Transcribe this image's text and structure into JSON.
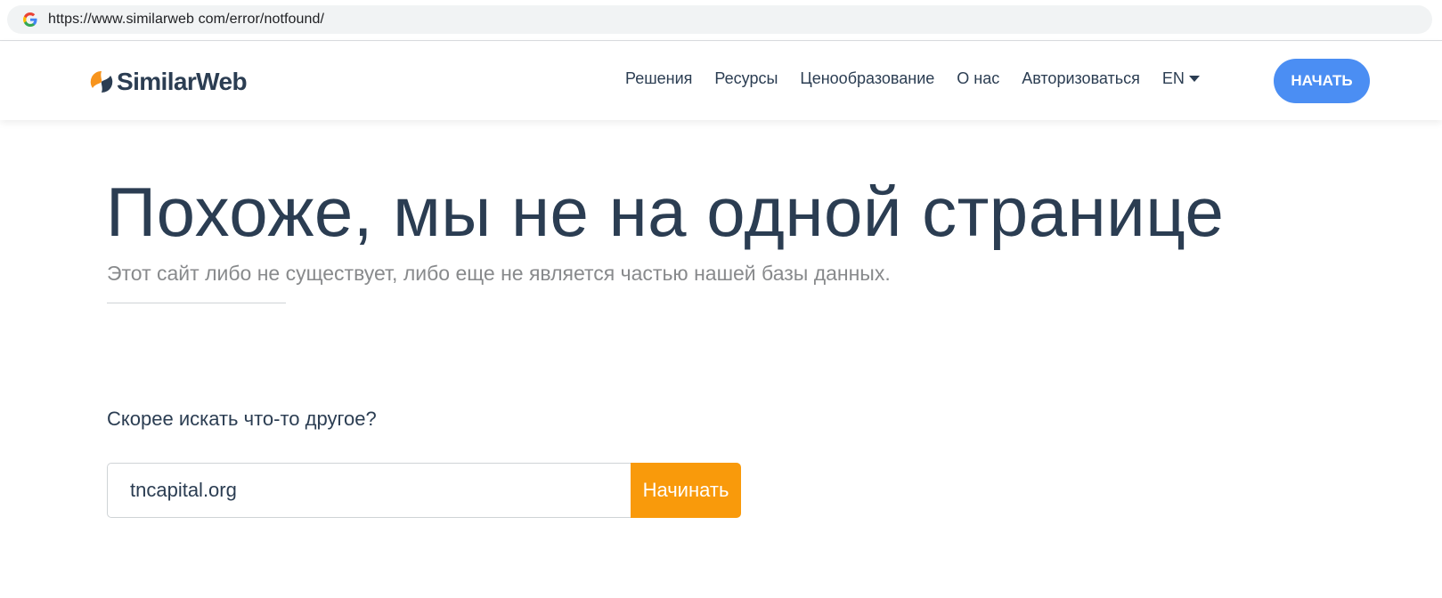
{
  "browser": {
    "url": "https://www.similarweb com/error/notfound/",
    "favicon": "google-g-icon"
  },
  "header": {
    "logo_text": "SimilarWeb",
    "nav": [
      "Решения",
      "Ресурсы",
      "Ценообразование",
      "О нас",
      "Авторизоваться"
    ],
    "language": "EN",
    "cta_label": "НАЧАТЬ"
  },
  "main": {
    "title": "Похоже, мы не на одной странице",
    "subtitle": "Этот сайт либо не существует, либо еще не является частью нашей базы данных.",
    "search_prompt": "Скорее искать что-то другое?",
    "search_value": "tncapital.org",
    "search_button": "Начинать"
  },
  "colors": {
    "text_primary": "#2b3d52",
    "text_muted": "#888a8c",
    "cta_blue": "#4b8ef3",
    "search_orange": "#f99a0b",
    "logo_orange": "#f7941d"
  }
}
